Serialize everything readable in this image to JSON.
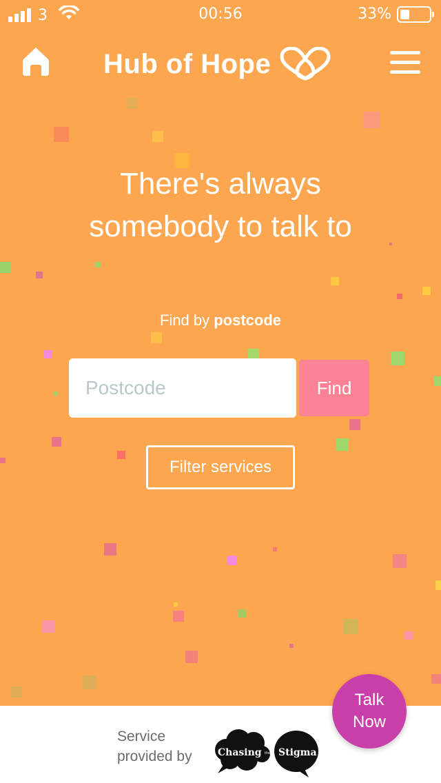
{
  "status_bar": {
    "carrier": "3",
    "time": "00:56",
    "battery_percent": "33%",
    "battery_level": 0.33,
    "signal_bars": 4
  },
  "header": {
    "logo_text": "Hub of Hope",
    "home_icon": "home-icon",
    "menu_icon": "hamburger-menu-icon"
  },
  "main": {
    "headline_line1": "There's always",
    "headline_line2": "somebody to talk to",
    "find_by_prefix": "Find by",
    "find_by_bold": "postcode",
    "postcode_placeholder": "Postcode",
    "postcode_value": "",
    "find_button": "Find",
    "filter_button": "Filter services"
  },
  "footer": {
    "provided_line1": "Service",
    "provided_line2": "provided by",
    "partner_logo_text": "Chasing the Stigma"
  },
  "talk_now": {
    "line1": "Talk",
    "line2": "Now"
  },
  "colors": {
    "background": "#FDA650",
    "find_button": "#F98395",
    "talk_now": "#C93FA9",
    "footer_bg": "#FFFFFF"
  }
}
